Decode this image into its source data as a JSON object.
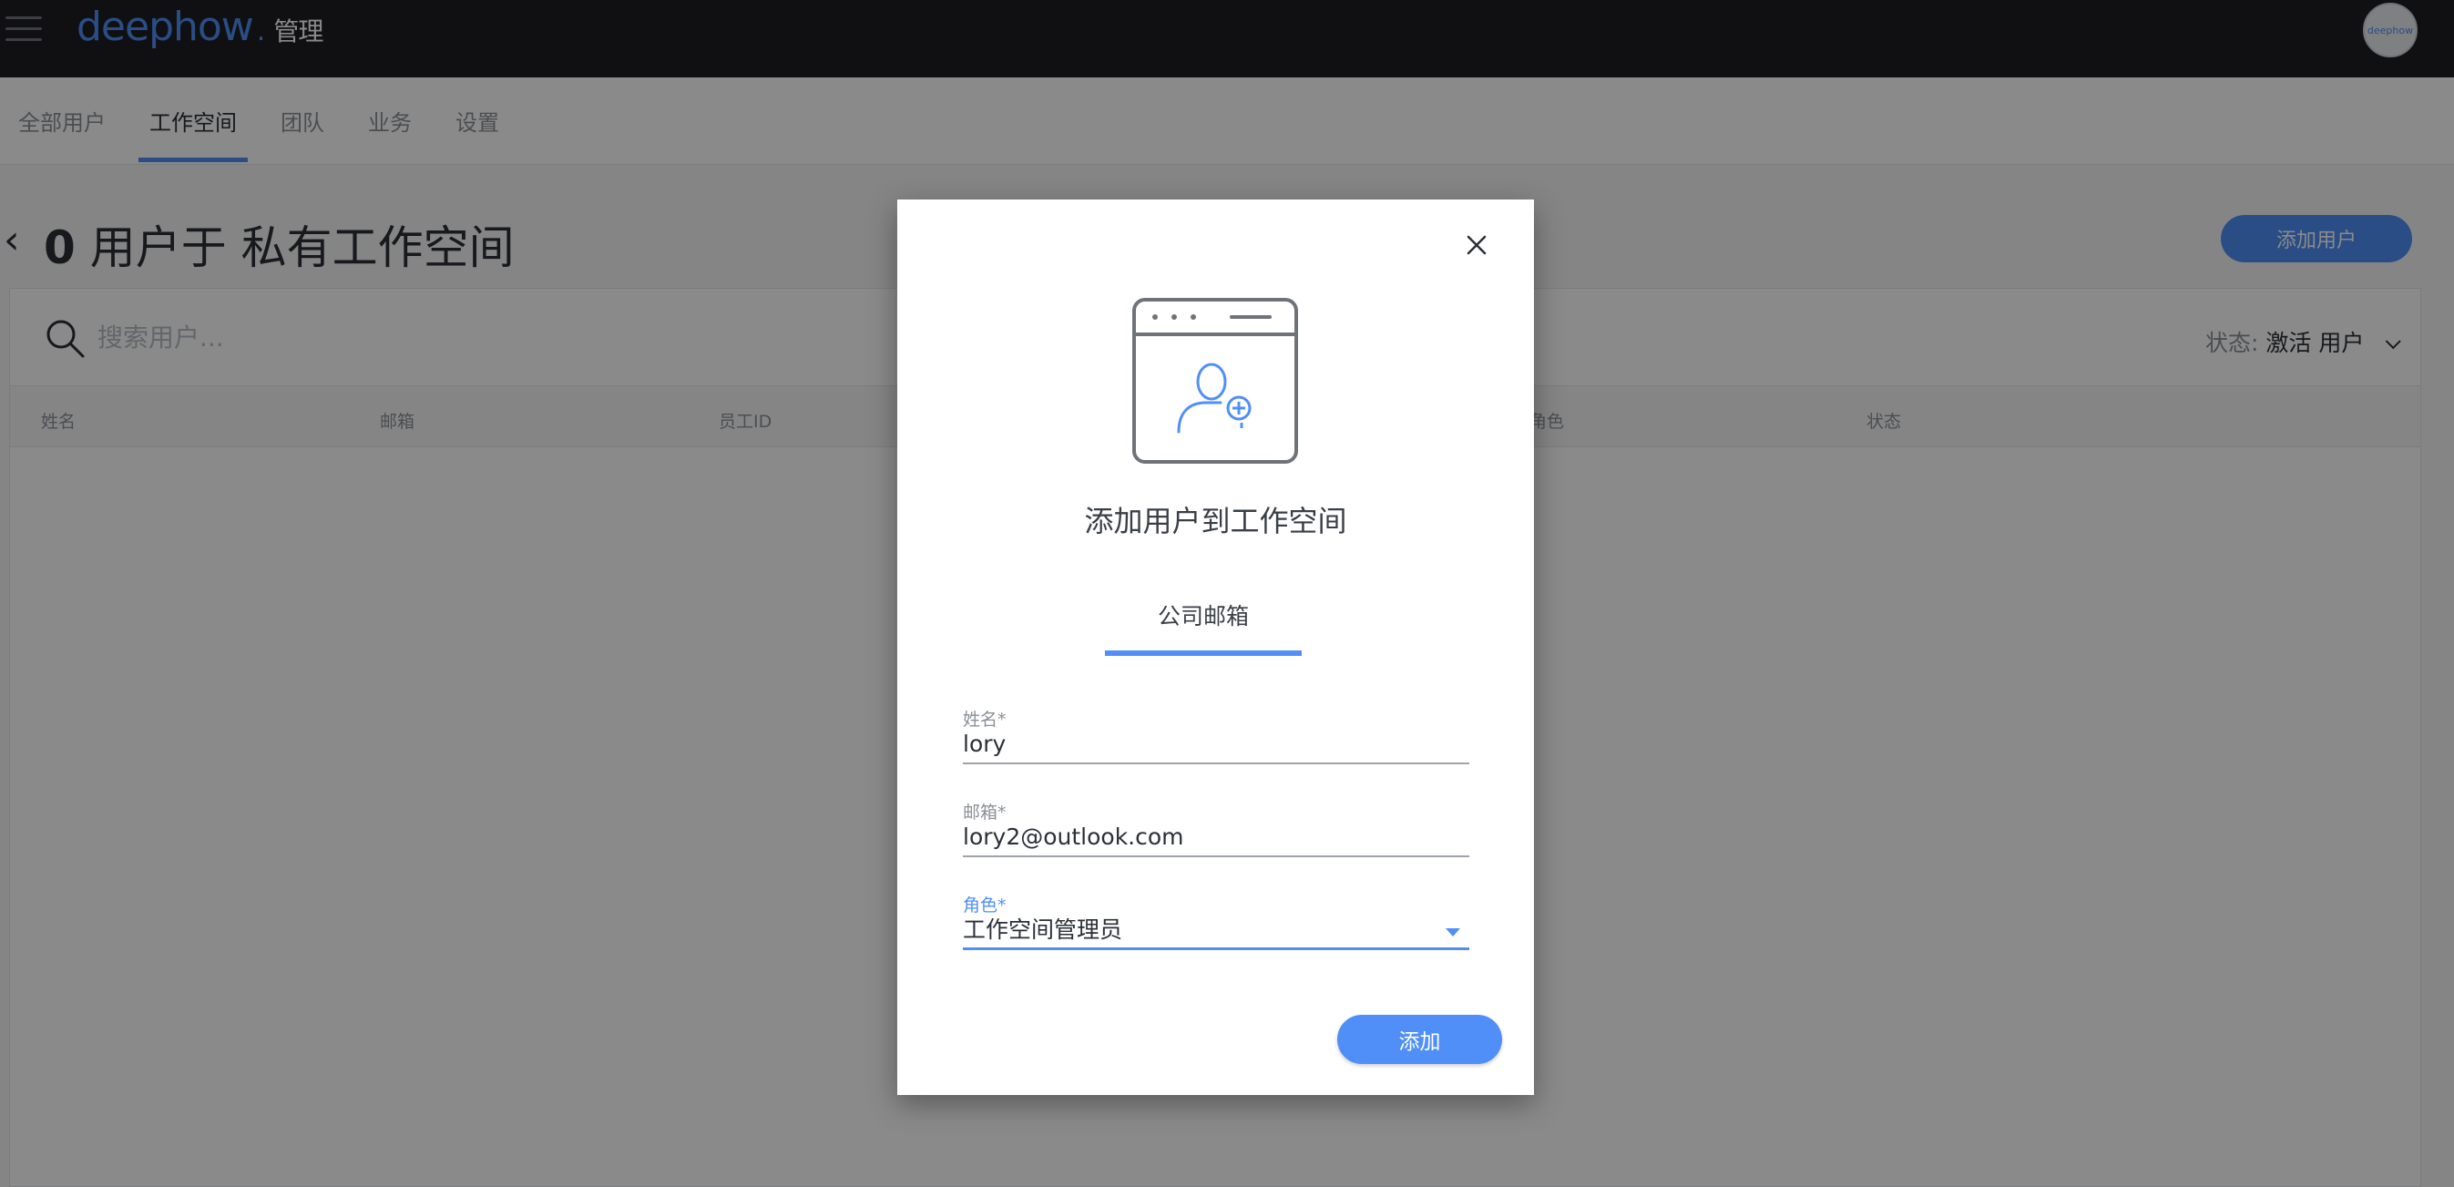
{
  "header": {
    "logo_text": "deephow",
    "admin_label": "管理",
    "avatar_text": "deephow"
  },
  "tabs": [
    {
      "label": "全部用户"
    },
    {
      "label": "工作空间"
    },
    {
      "label": "团队"
    },
    {
      "label": "业务"
    },
    {
      "label": "设置"
    }
  ],
  "active_tab": "工作空间",
  "page": {
    "title_count": "0",
    "title_rest": " 用户于 私有工作空间",
    "add_user_label": "添加用户"
  },
  "search": {
    "placeholder": "搜索用户..."
  },
  "status_filter": {
    "label": "状态:",
    "value": "激活 用户"
  },
  "table": {
    "columns": [
      "姓名",
      "邮箱",
      "员工ID",
      "角色",
      "状态"
    ]
  },
  "dialog": {
    "title": "添加用户到工作空间",
    "tab_label": "公司邮箱",
    "fields": {
      "name": {
        "label": "姓名*",
        "value": "lory"
      },
      "email": {
        "label": "邮箱*",
        "value": "lory2@outlook.com"
      },
      "role": {
        "label": "角色*",
        "value": "工作空间管理员"
      }
    },
    "submit_label": "添加"
  },
  "colors": {
    "accent": "#4f8ff7",
    "topbar": "#1e1f22"
  }
}
